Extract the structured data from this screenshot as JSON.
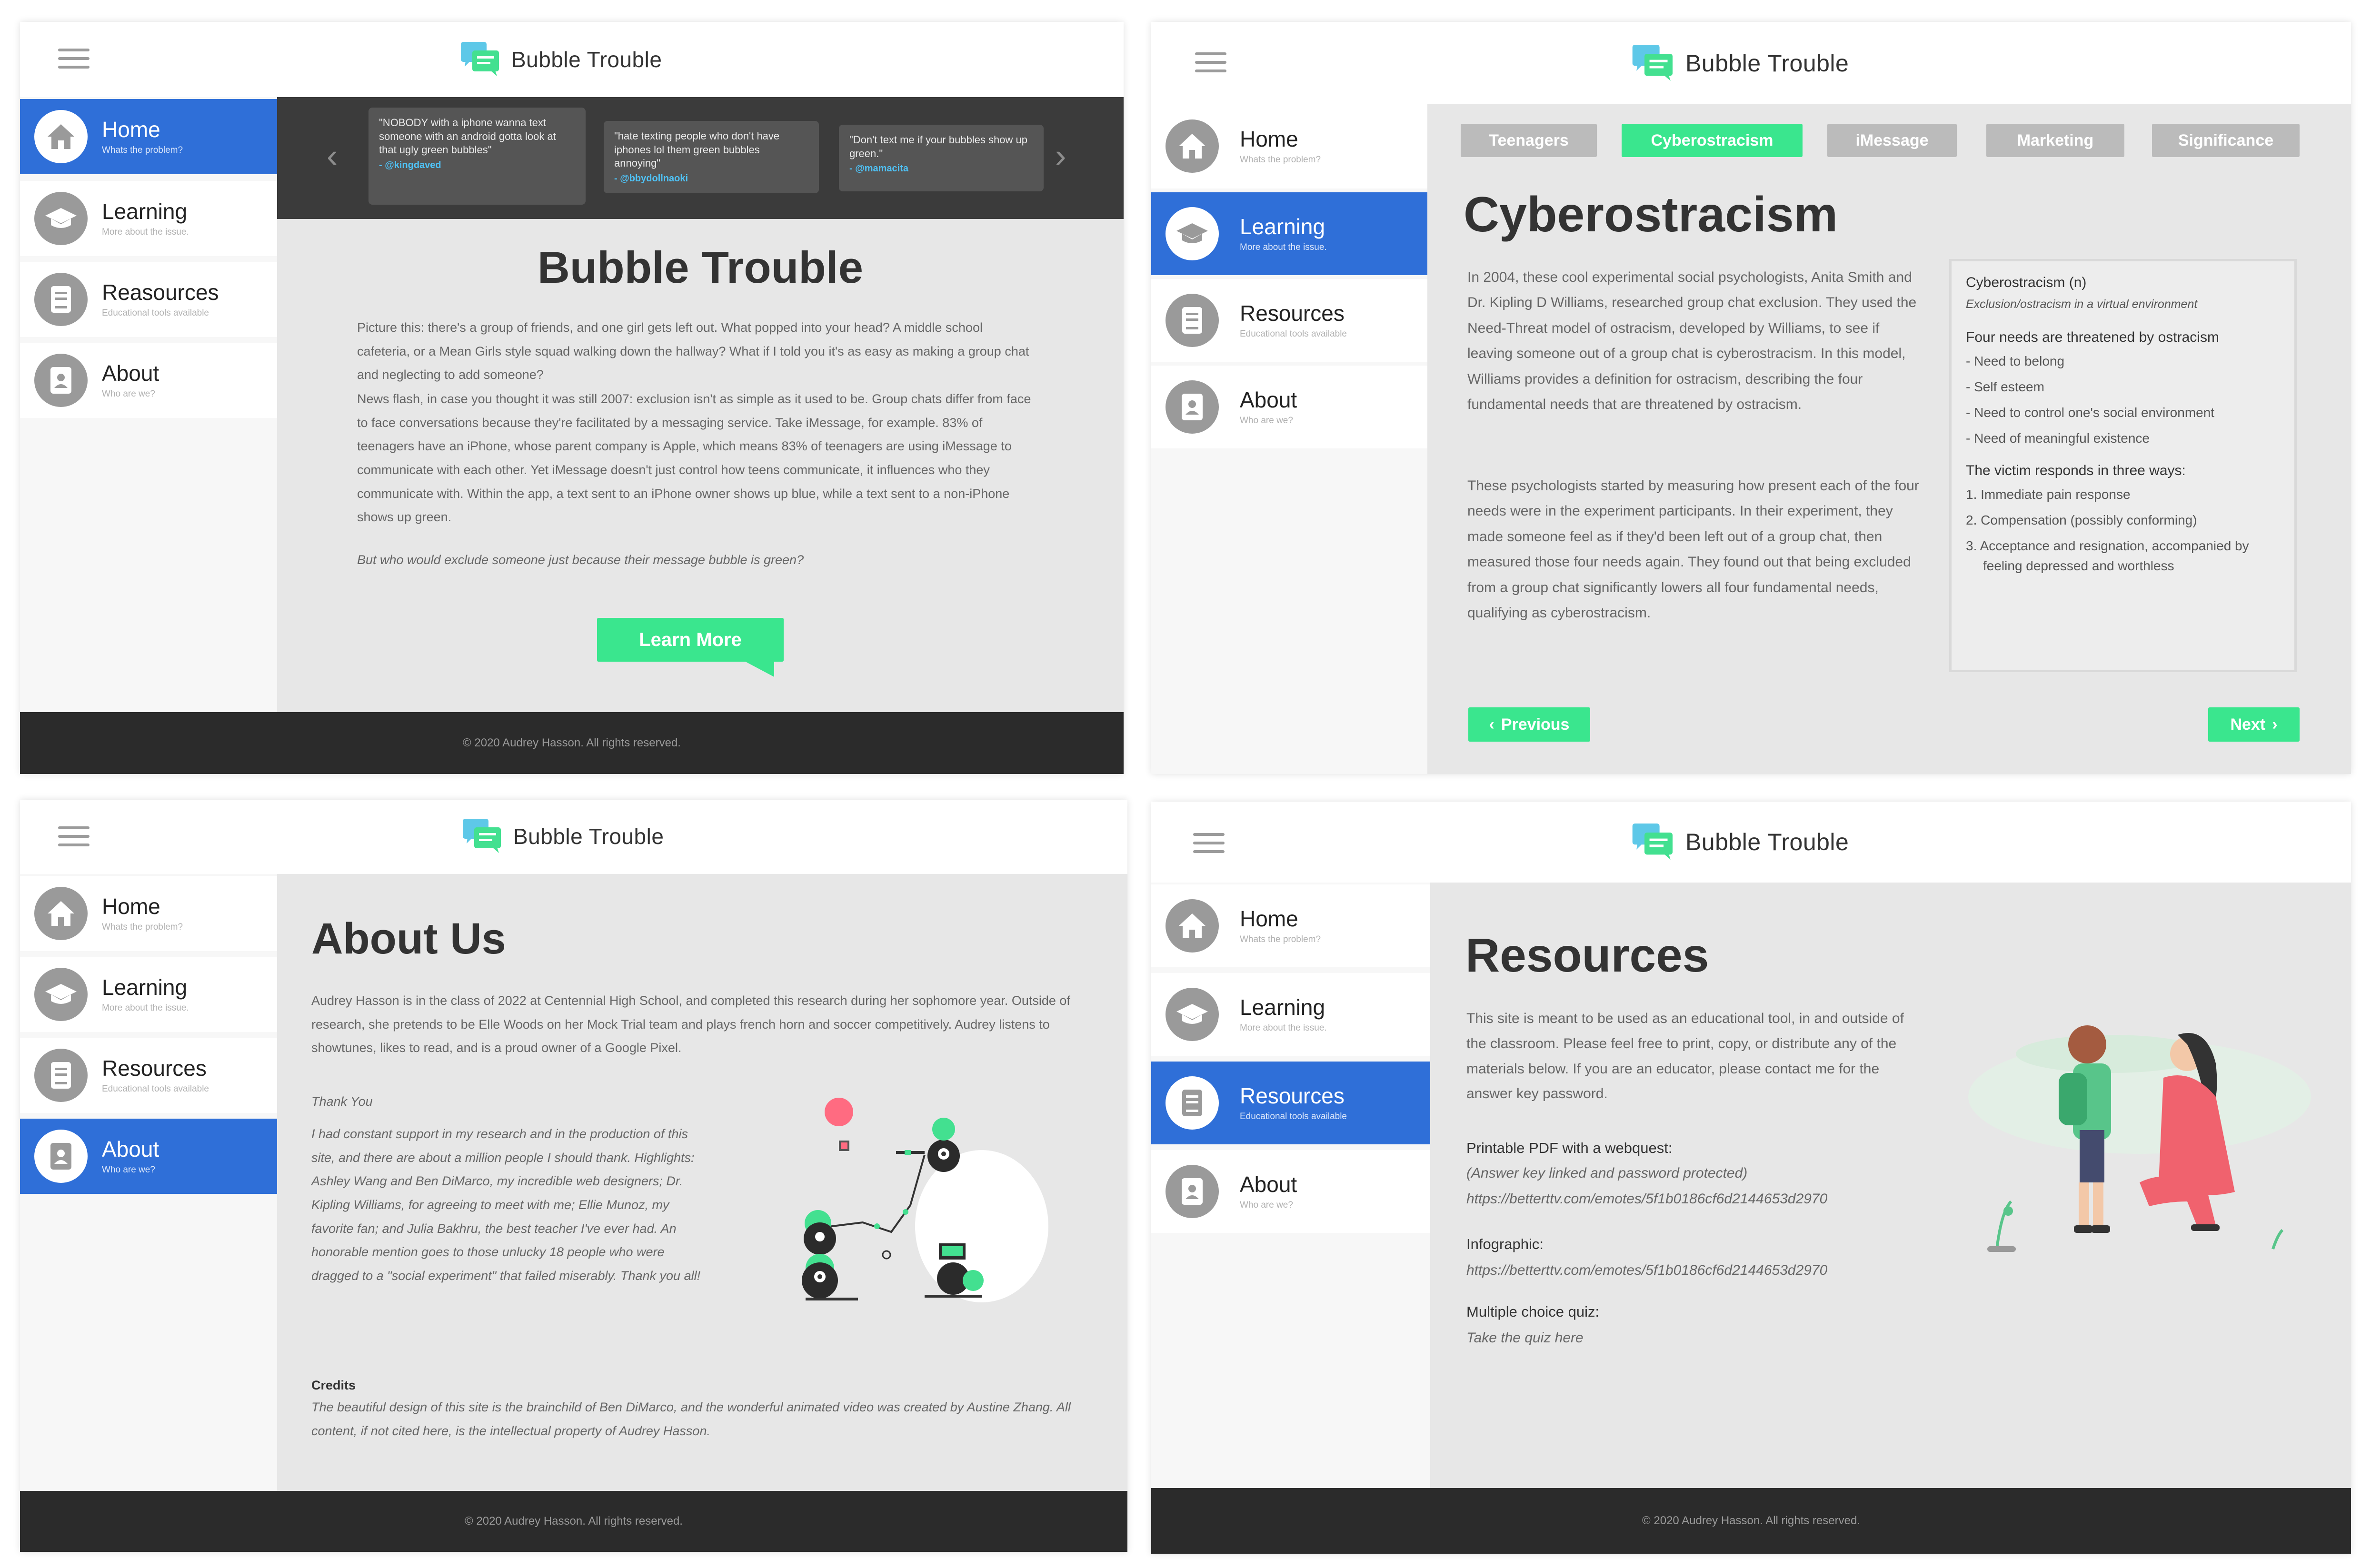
{
  "brand": {
    "title": "Bubble Trouble",
    "icon": "chat-bubbles-icon"
  },
  "nav": {
    "home": {
      "label": "Home",
      "sub": "Whats the problem?"
    },
    "learning": {
      "label": "Learning",
      "sub": "More about the issue."
    },
    "resources": {
      "label": "Reasources",
      "sub": "Educational tools available"
    },
    "resources_fixed": {
      "label": "Resources",
      "sub": "Educational tools available"
    },
    "about": {
      "label": "About",
      "sub": "Who are we?"
    }
  },
  "footer": "© 2020 Audrey Hasson. All rights reserved.",
  "home_page": {
    "quotes": [
      {
        "text": "\"NOBODY with a iphone wanna text someone with an android gotta look at that ugly green bubbles\"",
        "author": "- @kingdaved"
      },
      {
        "text": "\"hate texting people who don't have iphones lol them green bubbles annoying\"",
        "author": "- @bbydollnaoki"
      },
      {
        "text": "\"Don't text me if your bubbles show up green.\"",
        "author": "- @mamacita"
      }
    ],
    "title": "Bubble Trouble",
    "para1": "Picture this: there's a group of friends, and one girl gets left out. What popped into your head? A middle school cafeteria, or a Mean Girls style squad walking down the hallway? What if I told you it's as easy as making a group chat and neglecting to add someone?",
    "para2": "News flash, in case you thought it was still 2007: exclusion isn't as simple as it used to be. Group chats differ from face to face conversations because they're facilitated by a messaging service. Take iMessage, for example. 83% of teenagers have an iPhone, whose parent company is Apple, which means 83% of teenagers are using iMessage to communicate with each other. Yet iMessage doesn't just control how teens communicate, it influences who they communicate with. Within the app, a text sent to an iPhone owner shows up blue, while a text sent to a non-iPhone shows up green.",
    "para3": "But who would exclude someone just because their message bubble is green?",
    "button": "Learn More"
  },
  "learning_page": {
    "tabs": [
      "Teenagers",
      "Cyberostracism",
      "iMessage",
      "Marketing",
      "Significance"
    ],
    "title": "Cyberostracism",
    "para1": "In 2004, these cool experimental social psychologists, Anita Smith and Dr. Kipling D Williams, researched group chat exclusion. They used the Need-Threat model of ostracism, developed by Williams, to see if leaving someone out of a group chat is cyberostracism. In this model, Williams provides a definition for ostracism, describing the four fundamental needs that are threatened by ostracism.",
    "para2": "These psychologists started by measuring how present each of the four needs were in the experiment participants. In their experiment, they made someone feel as if they'd been left out of a group chat, then measured those four needs again. They found out that being excluded from a group chat significantly lowers all four fundamental needs, qualifying as cyberostracism.",
    "definition": {
      "term": "Cyberostracism",
      "pos": "(n)",
      "meaning": "Exclusion/ostracism in a virtual environment",
      "needs_head": "Four needs are threatened by ostracism",
      "needs": [
        "- Need to belong",
        "- Self esteem",
        "- Need to control one's social environment",
        "- Need of meaningful existence"
      ],
      "resp_head": "The victim responds in three ways:",
      "responses": [
        "1. Immediate pain response",
        "2. Compensation (possibly conforming)",
        "3. Acceptance and resignation, accompanied by feeling depressed and worthless"
      ]
    },
    "prev": "Previous",
    "next": "Next"
  },
  "about_page": {
    "title": "About Us",
    "bio": "Audrey Hasson is in the class of 2022 at Centennial High School, and completed this research during her sophomore year. Outside of research, she pretends to be Elle Woods on her Mock Trial team and plays french horn and soccer competitively. Audrey listens to showtunes, likes to read, and is a proud owner of a Google Pixel.",
    "thanks_head": "Thank You",
    "thanks": "I had constant support in my research and in the production of this site, and there are about a million people I should thank. Highlights: Ashley Wang and Ben DiMarco, my incredible web designers; Dr. Kipling Williams, for agreeing to meet with me; Ellie Munoz, my favorite fan; and Julia Bakhru, the best teacher I've ever had. An honorable mention goes to those unlucky 18 people who were dragged to a \"social experiment\" that failed miserably. Thank you all!",
    "credits_head": "Credits",
    "credits": "The beautiful design of this site is the brainchild of Ben DiMarco, and the wonderful animated video was created by Austine Zhang. All content, if not cited here, is the intellectual property of Audrey Hasson."
  },
  "resources_page": {
    "title": "Resources",
    "intro": "This site is meant to be used as an educational tool, in and outside of the classroom. Please feel free to print, copy, or distribute any of the materials below. If you are an educator, please contact me for the answer key password.",
    "pdf_label": "Printable PDF with a webquest:",
    "pdf_note": "(Answer key linked and password protected)",
    "pdf_link": "https://betterttv.com/emotes/5f1b0186cf6d2144653d2970",
    "info_label": "Infographic:",
    "info_link": "https://betterttv.com/emotes/5f1b0186cf6d2144653d2970",
    "quiz_label": "Multiple choice quiz:",
    "quiz_link": "Take the quiz here"
  },
  "colors": {
    "accent_blue": "#2f6fd8",
    "accent_green": "#3ae68e",
    "footer": "#2b2b2b",
    "link": "#6e6ee6"
  }
}
